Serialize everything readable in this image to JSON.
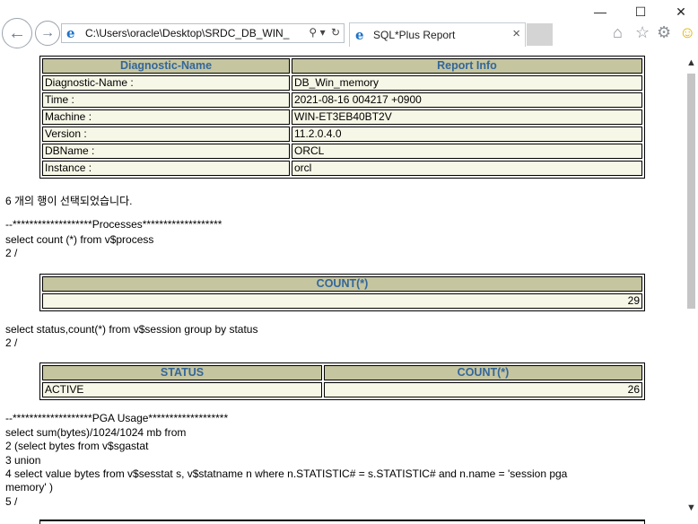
{
  "browser": {
    "url": "C:\\Users\\oracle\\Desktop\\SRDC_DB_WIN_",
    "search_glyph": "⚲",
    "dropdown_glyph": "▾",
    "refresh_glyph": "↻",
    "tab_title": "SQL*Plus Report",
    "tab_close": "×",
    "back_glyph": "←",
    "forward_glyph": "→",
    "minimize_glyph": "—",
    "maximize_glyph": "☐",
    "close_glyph": "✕",
    "home_glyph": "⌂",
    "star_glyph": "☆",
    "gear_glyph": "⚙",
    "smiley_glyph": "☺"
  },
  "diag_table": {
    "headers": [
      "Diagnostic-Name",
      "Report Info"
    ],
    "rows": [
      [
        "Diagnostic-Name :",
        "DB_Win_memory"
      ],
      [
        "Time :",
        "2021-08-16 004217 +0900"
      ],
      [
        "Machine :",
        "WIN-ET3EB40BT2V"
      ],
      [
        "Version :",
        "11.2.0.4.0"
      ],
      [
        "DBName :",
        "ORCL"
      ],
      [
        "Instance :",
        "orcl"
      ]
    ]
  },
  "rows_selected": "6 개의 행이 선택되었습니다.",
  "processes": {
    "banner": "--*******************Processes*******************",
    "sql1": "select count (*) from v$process",
    "sql2": "2 /",
    "header": "COUNT(*)",
    "value": "29"
  },
  "sessions": {
    "sql1": "select status,count(*) from v$session group by status",
    "sql2": "2 /",
    "headers": [
      "STATUS",
      "COUNT(*)"
    ],
    "row": [
      "ACTIVE",
      "26"
    ]
  },
  "pga": {
    "banner": "--*******************PGA Usage*******************",
    "lines": [
      "select sum(bytes)/1024/1024 mb from",
      "2 (select bytes from v$sgastat",
      "3 union",
      "4 select value bytes from v$sesstat s, v$statname n where n.STATISTIC# = s.STATISTIC# and n.name = 'session pga",
      "memory' )",
      "5 /"
    ]
  }
}
